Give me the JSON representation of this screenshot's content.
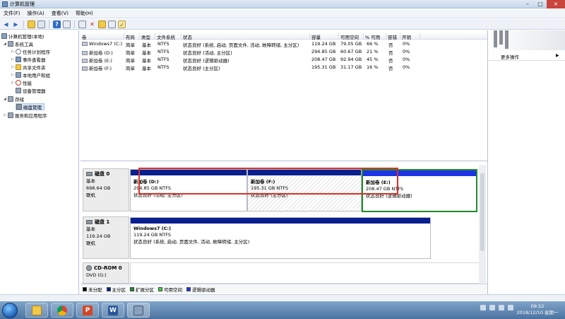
{
  "window": {
    "title": "计算机管理"
  },
  "menu": [
    "文件(F)",
    "操作(A)",
    "查看(V)",
    "帮助(H)"
  ],
  "tree": {
    "root": "计算机管理(本地)",
    "system_tools": "系统工具",
    "task_scheduler": "任务计划程序",
    "event_viewer": "事件查看器",
    "shared_folders": "共享文件夹",
    "local_users": "本地用户和组",
    "performance": "性能",
    "device_manager": "设备管理器",
    "storage": "存储",
    "disk_management": "磁盘管理",
    "services": "服务和应用程序"
  },
  "volume_list": {
    "headers": [
      "卷",
      "布局",
      "类型",
      "文件系统",
      "状态",
      "容量",
      "可用空间",
      "% 可用",
      "容错",
      "开销"
    ],
    "rows": [
      [
        "Windows7 (C:)",
        "简单",
        "基本",
        "NTFS",
        "状态良好 (系统, 启动, 页面文件, 活动, 故障转储, 主分区)",
        "119.24 GB",
        "79.05 GB",
        "66 %",
        "否",
        "0%"
      ],
      [
        "新加卷 (D:)",
        "简单",
        "基本",
        "NTFS",
        "状态良好 (活动, 主分区)",
        "294.85 GB",
        "60.67 GB",
        "21 %",
        "否",
        "0%"
      ],
      [
        "新加卷 (E:)",
        "简单",
        "基本",
        "NTFS",
        "状态良好 (逻辑驱动器)",
        "208.47 GB",
        "92.94 GB",
        "45 %",
        "否",
        "0%"
      ],
      [
        "新加卷 (F:)",
        "简单",
        "基本",
        "NTFS",
        "状态良好 (主分区)",
        "195.31 GB",
        "31.17 GB",
        "16 %",
        "否",
        "0%"
      ]
    ]
  },
  "actions": {
    "more": "更多操作"
  },
  "disks": [
    {
      "name": "磁盘 0",
      "type": "基本",
      "size": "698.64 GB",
      "status": "联机"
    },
    {
      "name": "磁盘 1",
      "type": "基本",
      "size": "119.24 GB",
      "status": "联机"
    },
    {
      "name": "CD-ROM 0",
      "type": "DVD (G:)"
    }
  ],
  "partitions": {
    "d": {
      "name": "新加卷  (D:)",
      "size": "294.85 GB NTFS",
      "status": "状态良好 (活动, 主分区)"
    },
    "f": {
      "name": "新加卷  (F:)",
      "size": "195.31 GB NTFS",
      "status": "状态良好 (主分区)"
    },
    "e": {
      "name": "新加卷  (E:)",
      "size": "208.47 GB NTFS",
      "status": "状态良好 (逻辑驱动器)"
    },
    "c": {
      "name": "Windows7  (C:)",
      "size": "119.24 GB NTFS",
      "status": "状态良好 (系统, 启动, 页面文件, 活动, 故障转储, 主分区)"
    }
  },
  "legend": [
    {
      "label": "未分配",
      "color": "#000000"
    },
    {
      "label": "主分区",
      "color": "#0a1f8f"
    },
    {
      "label": "扩展分区",
      "color": "#1f8c2a"
    },
    {
      "label": "可用空间",
      "color": "#39d43d"
    },
    {
      "label": "逻辑驱动器",
      "color": "#1b35e6"
    }
  ],
  "clock": {
    "time": "09:52",
    "date": "2018/12/10 星期一"
  },
  "colors": {
    "primary": "#0a1f8f",
    "logical": "#1b35e6",
    "extended": "#1f8c2a",
    "highlight": "#d9302a"
  }
}
